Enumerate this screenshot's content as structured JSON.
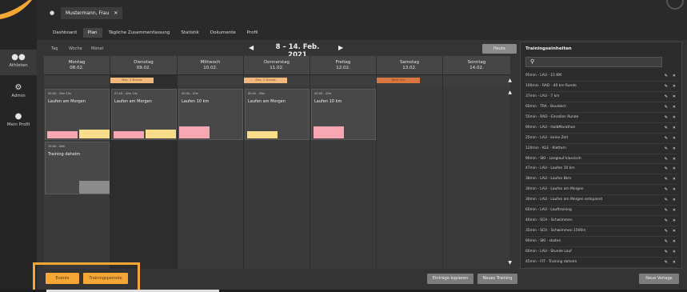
{
  "nav": {
    "items": [
      {
        "label": "Athleten"
      },
      {
        "label": "Admin"
      },
      {
        "label": "Mein Profil"
      }
    ]
  },
  "header": {
    "user_tab": "Mustermann, Frau",
    "tabs": [
      "Dashboard",
      "Plan",
      "Tägliche Zusammenfassung",
      "Statistik",
      "Dokumente",
      "Profil"
    ]
  },
  "toolbar": {
    "views": [
      "Tag",
      "Woche",
      "Monat"
    ],
    "date_range": "8 – 14. Feb. 2021",
    "today": "Heute"
  },
  "calendar": {
    "days": [
      {
        "name": "Montag",
        "date": "08.02."
      },
      {
        "name": "Dienstag",
        "date": "09.02."
      },
      {
        "name": "Mittwoch",
        "date": "10.02."
      },
      {
        "name": "Donnerstag",
        "date": "11.02."
      },
      {
        "name": "Freitag",
        "date": "12.02."
      },
      {
        "name": "Samstag",
        "date": "13.02."
      },
      {
        "name": "Sonntag",
        "date": "14.02."
      }
    ],
    "chips": [
      {
        "label": "Max. 2 Stunde"
      },
      {
        "label": "Max. 2 Stunde"
      },
      {
        "label": "Rote Gen"
      }
    ],
    "events": [
      {
        "time": "00:00 - 35m 15s",
        "title": "Laufen am Morgen"
      },
      {
        "time": "07:49 - 42m 15s",
        "title": "Laufen am Morgen"
      },
      {
        "time": "00:00 - 47m",
        "title": "Laufen 10 km"
      },
      {
        "time": "00:00 - 30m",
        "title": "Laufen am Morgen"
      },
      {
        "time": "00:00 - 47m",
        "title": "Laufen 10 km"
      },
      {
        "time": "15:00 - 45m",
        "title": "Training daheim"
      }
    ]
  },
  "buttons": {
    "events": "Events",
    "training_period": "Trainingsperiode",
    "copy_entries": "Einträge kopieren",
    "new_training": "Neues Training",
    "new_template": "Neue Vorlage"
  },
  "panel": {
    "title": "Trainingseinheiten",
    "items": [
      "95min - LAU - 15 KM",
      "100min - RAD - 40 km Runde",
      "37min - LAU - 7 km",
      "60min - TRA - Bouldern",
      "55min - RAD - Einrollen Runde",
      "90min - LAU - HalbMarathon",
      "25min - LAU - keine Zeit",
      "120min - KLE - Klettern",
      "90min - SKI - Langlauf klassisch",
      "47min - LAU - Laufen 10 km",
      "38min - LAU - Laufen 8km",
      "30min - LAU - Laufen am Morgen",
      "30min - LAU - Laufen am Morgen entspannt",
      "60min - LAU - Lauftraining",
      "40min - SCH - Schwimmen",
      "35min - SCH - Schwimmen 1500m",
      "90min - SKI - skaten",
      "60min - LAU - Stunde Lauf",
      "45min - FIT - Training daheim"
    ]
  }
}
